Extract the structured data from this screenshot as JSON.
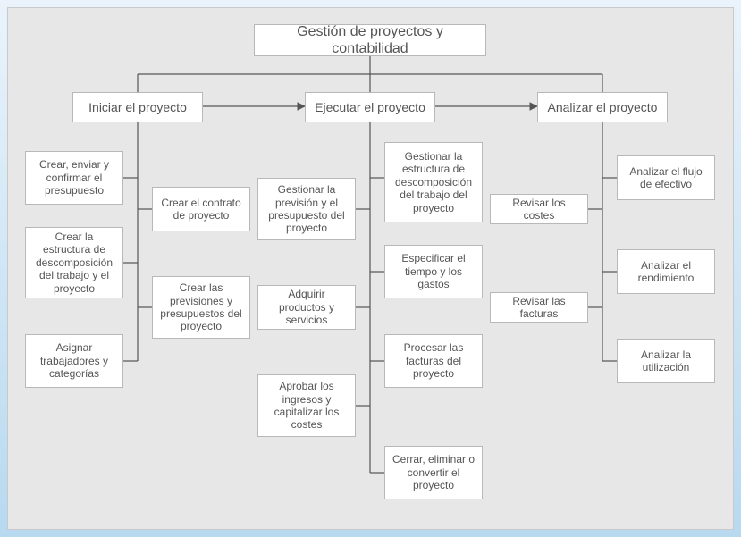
{
  "root": {
    "title": "Gestión de proyectos y contabilidad"
  },
  "phases": {
    "initiate": {
      "label": "Iniciar el proyecto"
    },
    "execute": {
      "label": "Ejecutar el proyecto"
    },
    "analyze": {
      "label": "Analizar el proyecto"
    }
  },
  "tasks": {
    "initiate_left": [
      "Crear, enviar y confirmar el presupuesto",
      "Crear la estructura de descomposición del trabajo y el proyecto",
      "Asignar trabajadores y categorías"
    ],
    "initiate_right": [
      "Crear el contrato de proyecto",
      "Crear las previsiones y presupuestos del proyecto"
    ],
    "execute_left": [
      "Gestionar la previsión y el presupuesto del proyecto",
      "Adquirir productos y servicios",
      "Aprobar los ingresos y capitalizar los costes"
    ],
    "execute_right": [
      "Gestionar la estructura de descomposición del trabajo del proyecto",
      "Especificar el tiempo y los gastos",
      "Procesar las facturas del proyecto",
      "Cerrar, eliminar o convertir el proyecto"
    ],
    "analyze_left": [
      "Revisar los costes",
      "Revisar las facturas"
    ],
    "analyze_right": [
      "Analizar el flujo de efectivo",
      "Analizar el rendimiento",
      "Analizar la utilización"
    ]
  }
}
